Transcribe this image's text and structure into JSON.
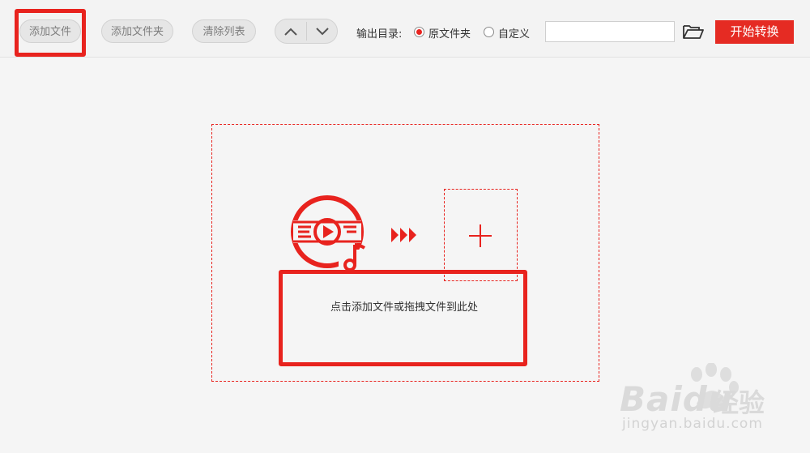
{
  "toolbar": {
    "add_file": "添加文件",
    "add_folder": "添加文件夹",
    "clear_list": "清除列表",
    "output_dir_label": "输出目录:",
    "option_original": "原文件夹",
    "option_custom": "自定义",
    "selected_option": "原文件夹",
    "path_value": "",
    "start_convert": "开始转换"
  },
  "dropzone": {
    "hint": "点击添加文件或拖拽文件到此处"
  },
  "watermark": {
    "brand": "Bai",
    "brand2": "du",
    "brand_cn": "经验",
    "url": "jingyan.baidu.com"
  },
  "colors": {
    "accent": "#e52b23",
    "annotation": "#e8231e",
    "background": "#f5f5f5"
  },
  "icons": {
    "folder": "folder-open-icon",
    "up": "chevron-up-icon",
    "down": "chevron-down-icon",
    "media": "video-music-disc-icon",
    "forward": "triple-chevron-right-icon",
    "plus": "plus-icon"
  }
}
